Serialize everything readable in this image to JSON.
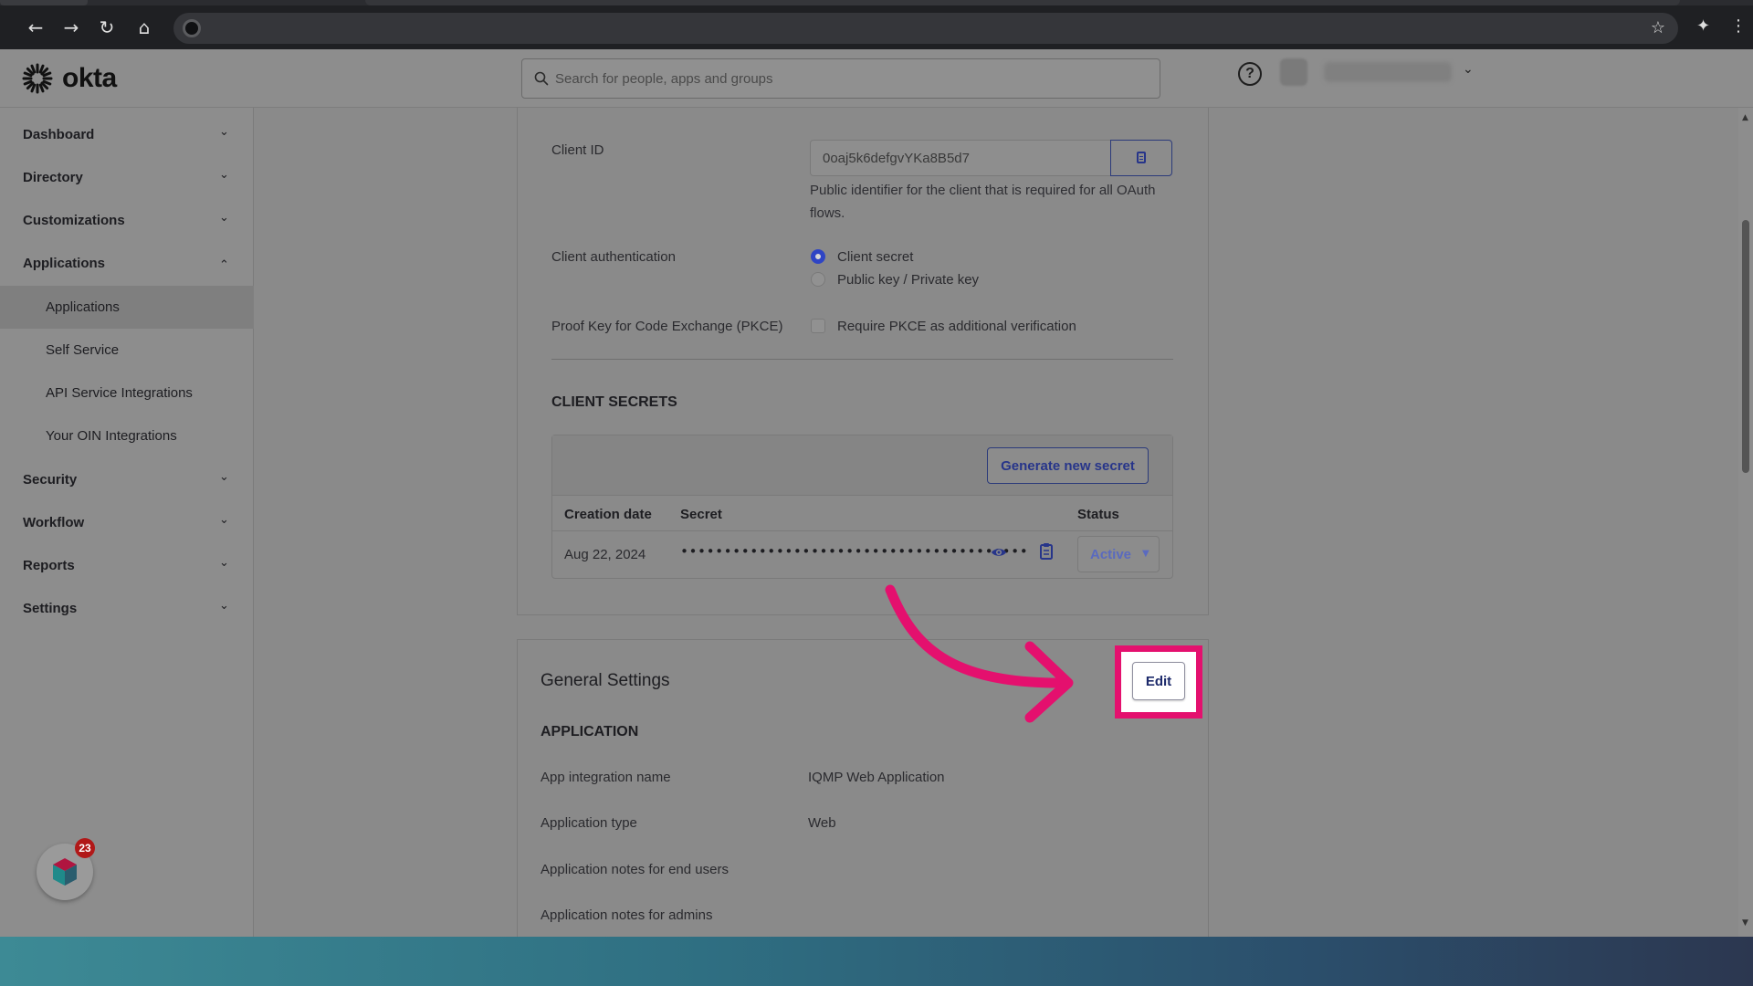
{
  "browser": {
    "back_icon": "back-arrow-icon",
    "forward_icon": "forward-arrow-icon",
    "reload_icon": "reload-icon",
    "home_icon": "home-icon",
    "bookmark_icon": "star-icon",
    "extensions_icon": "puzzle-icon",
    "menu_icon": "kebab-menu-icon"
  },
  "header": {
    "logo_text": "okta",
    "search_placeholder": "Search for people, apps and groups",
    "help_glyph": "?"
  },
  "sidebar": {
    "items": [
      {
        "label": "Dashboard",
        "expanded": false
      },
      {
        "label": "Directory",
        "expanded": false
      },
      {
        "label": "Customizations",
        "expanded": false
      },
      {
        "label": "Applications",
        "expanded": true
      },
      {
        "label": "Security",
        "expanded": false
      },
      {
        "label": "Workflow",
        "expanded": false
      },
      {
        "label": "Reports",
        "expanded": false
      },
      {
        "label": "Settings",
        "expanded": false
      }
    ],
    "sub_items": [
      {
        "label": "Applications",
        "active": true
      },
      {
        "label": "Self Service",
        "active": false
      },
      {
        "label": "API Service Integrations",
        "active": false
      },
      {
        "label": "Your OIN Integrations",
        "active": false
      }
    ],
    "notification_count": "23"
  },
  "credentials": {
    "client_id_label": "Client ID",
    "client_id_value": "0oaj5k6defgvYKa8B5d7",
    "client_id_help": "Public identifier for the client that is required for all OAuth flows.",
    "client_auth_label": "Client authentication",
    "client_auth_options": [
      "Client secret",
      "Public key / Private key"
    ],
    "client_auth_selected": "Client secret",
    "pkce_label": "Proof Key for Code Exchange (PKCE)",
    "pkce_option": "Require PKCE as additional verification",
    "pkce_checked": false
  },
  "client_secrets": {
    "heading": "CLIENT SECRETS",
    "generate_button": "Generate new secret",
    "columns": [
      "Creation date",
      "Secret",
      "Status"
    ],
    "rows": [
      {
        "creation_date": "Aug 22, 2024",
        "secret": "••••••••••••••••••••••••••••••••••••••••",
        "status": "Active"
      }
    ]
  },
  "general_settings": {
    "title": "General Settings",
    "edit_button": "Edit",
    "section": "APPLICATION",
    "fields": [
      {
        "label": "App integration name",
        "value": "IQMP Web Application"
      },
      {
        "label": "Application type",
        "value": "Web"
      },
      {
        "label": "Application notes for end users",
        "value": ""
      },
      {
        "label": "Application notes for admins",
        "value": ""
      }
    ]
  },
  "colors": {
    "highlight": "#e4106e",
    "accent": "#2f45c4",
    "desktop_start": "#3d8a95",
    "desktop_end": "#2c3750"
  }
}
